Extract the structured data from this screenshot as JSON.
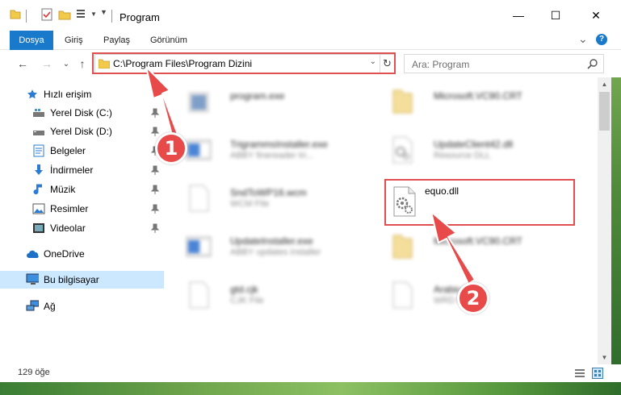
{
  "window": {
    "title": "Program",
    "minimize_glyph": "—",
    "maximize_glyph": "☐",
    "close_glyph": "✕"
  },
  "ribbon": {
    "tabs": [
      "Dosya",
      "Giriş",
      "Paylaş",
      "Görünüm"
    ],
    "collapse_glyph": "⌄",
    "help_glyph": "?"
  },
  "address": {
    "path": "C:\\Program Files\\Program Dizini",
    "search_placeholder": "Ara: Program",
    "back_glyph": "←",
    "forward_glyph": "→",
    "recent_glyph": "⌄",
    "up_glyph": "↑",
    "dropdown_glyph": "⌄",
    "refresh_glyph": "↻"
  },
  "sidebar": {
    "quick_access": "Hızlı erişim",
    "items": [
      {
        "label": "Yerel Disk (C:)",
        "icon": "drive-icon"
      },
      {
        "label": "Yerel Disk (D:)",
        "icon": "drive-icon"
      },
      {
        "label": "Belgeler",
        "icon": "documents-icon"
      },
      {
        "label": "İndirmeler",
        "icon": "downloads-icon"
      },
      {
        "label": "Müzik",
        "icon": "music-icon"
      },
      {
        "label": "Resimler",
        "icon": "pictures-icon"
      },
      {
        "label": "Videolar",
        "icon": "videos-icon"
      }
    ],
    "onedrive": "OneDrive",
    "this_pc": "Bu bilgisayar",
    "network": "Ağ"
  },
  "files": [
    {
      "name": "program.exe",
      "desc": "",
      "icon": "exe-icon",
      "col": 0,
      "row": 0
    },
    {
      "name": "Microsoft.VC90.CRT",
      "desc": "",
      "icon": "folder-icon",
      "col": 1,
      "row": 0
    },
    {
      "name": "TrigrammsInstaller.exe",
      "desc": "ABBY finereader tri...",
      "icon": "installer-icon",
      "col": 0,
      "row": 1
    },
    {
      "name": "UpdateClient42.dll",
      "desc": "Resource DLL",
      "icon": "dll-icon",
      "col": 1,
      "row": 1
    },
    {
      "name": "SndToWP16.wcm",
      "desc": "WCM File",
      "icon": "blank-file-icon",
      "col": 0,
      "row": 2
    },
    {
      "name": "equo.dll",
      "desc": "",
      "icon": "dll-icon",
      "col": 1,
      "row": 2
    },
    {
      "name": "UpdateInstaller.exe",
      "desc": "ABBY updates installer",
      "icon": "installer-icon",
      "col": 0,
      "row": 3
    },
    {
      "name": "Microsoft.VC90.CRT",
      "desc": "",
      "icon": "folder-icon",
      "col": 1,
      "row": 3
    },
    {
      "name": "gtd.cjk",
      "desc": "CJK File",
      "icon": "blank-file-icon",
      "col": 0,
      "row": 4
    },
    {
      "name": "Arabic.lcd",
      "desc": "WRD File",
      "icon": "blank-file-icon",
      "col": 1,
      "row": 4
    }
  ],
  "status": {
    "item_count": "129 öğe"
  },
  "callouts": {
    "step1": "1",
    "step2": "2"
  },
  "colors": {
    "accent": "#1979ca",
    "highlight": "#e05050",
    "badge": "#e84a4a",
    "selected": "#cce8ff"
  }
}
